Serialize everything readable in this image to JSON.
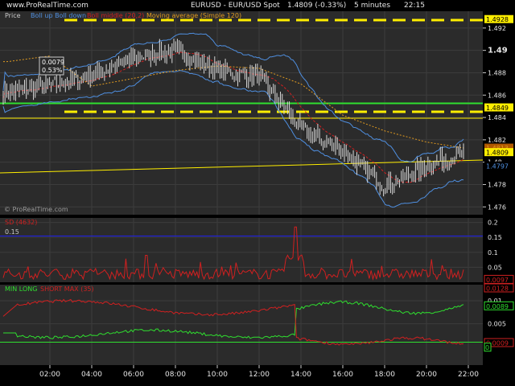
{
  "header": {
    "watermark": "www.ProRealTime.com",
    "symbol": "EURUSD - EUR/USD Spot",
    "last": "1.4809 (-0.33%)",
    "period": "5 minutes",
    "time": "22:15"
  },
  "price_panel": {
    "legend": [
      {
        "label": "Price",
        "color": "#c8c8c8"
      },
      {
        "label": "Boll up Boll down",
        "color": "#4f8fe0"
      },
      {
        "label": "Boll middle (20,2)",
        "color": "#d02020"
      },
      {
        "label": "Moving average (Simple 120)",
        "color": "#e09a20"
      }
    ],
    "footer": "© ProRealTime.com",
    "annotation": [
      "0.0079",
      "0.53%"
    ],
    "y_ticks": [
      "1.492",
      "1.49",
      "1.488",
      "1.486",
      "1.484",
      "1.482",
      "1.48",
      "1.478",
      "1.476"
    ],
    "y_min": 1.4753,
    "y_max": 1.4935,
    "level_badges": [
      {
        "text": "1.4928",
        "value": 1.4928,
        "fill": "#ffee00",
        "color": "#000000"
      },
      {
        "text": "1.4849",
        "value": 1.4849,
        "fill": "#ffee00",
        "color": "#000000"
      },
      {
        "text": "1.4813",
        "value": 1.4813,
        "fill": "#b05800",
        "color": "#e09a20"
      },
      {
        "text": "1.4809",
        "value": 1.4809,
        "fill": "#ffee00",
        "color": "#000000"
      },
      {
        "text": "1.4797",
        "value": 1.4797,
        "fill": "#000000",
        "color": "#4f8fe0"
      }
    ]
  },
  "sd_panel": {
    "label": "SD (4632)",
    "level_label": "0.15",
    "y_ticks": [
      "0.2",
      "0.15",
      "0.1",
      "0.05"
    ],
    "value_badge": "0.0097"
  },
  "minmax_panel": {
    "label_green": "MIN LONG",
    "label_red": "SHORT MAX (35)",
    "y_ticks": [
      "0.01",
      "0.005",
      "0"
    ],
    "badges": [
      "0.0128",
      "0.0089",
      "0.0009",
      "0"
    ]
  },
  "x_axis": {
    "ticks": [
      "02:00",
      "04:00",
      "06:00",
      "08:00",
      "10:00",
      "12:00",
      "14:00",
      "16:00",
      "18:00",
      "20:00",
      "22:00"
    ]
  },
  "chart_data": {
    "type": "line",
    "title": "EURUSD - EUR/USD Spot",
    "x": [
      "02:00",
      "04:00",
      "06:00",
      "08:00",
      "10:00",
      "12:00",
      "14:00",
      "16:00",
      "18:00",
      "20:00",
      "22:00"
    ],
    "series": [
      {
        "name": "Price",
        "values": [
          1.4868,
          1.4877,
          1.4893,
          1.49,
          1.4882,
          1.4876,
          1.483,
          1.481,
          1.4778,
          1.4797,
          1.481
        ]
      },
      {
        "name": "Moving average (Simple 120)",
        "values": [
          1.4895,
          1.4868,
          1.4875,
          1.4882,
          1.4886,
          1.4884,
          1.487,
          1.4842,
          1.4828,
          1.4818,
          1.4812
        ]
      }
    ],
    "horizontal_levels": [
      1.4928,
      1.4849
    ],
    "ylim": [
      1.4753,
      1.4935
    ],
    "sd_series": {
      "name": "SD (4632)",
      "level": 0.15,
      "last": 0.0097
    },
    "minmax_last": {
      "MIN LONG": 0.0089,
      "SHORT MAX (35)": 0.0009
    }
  }
}
